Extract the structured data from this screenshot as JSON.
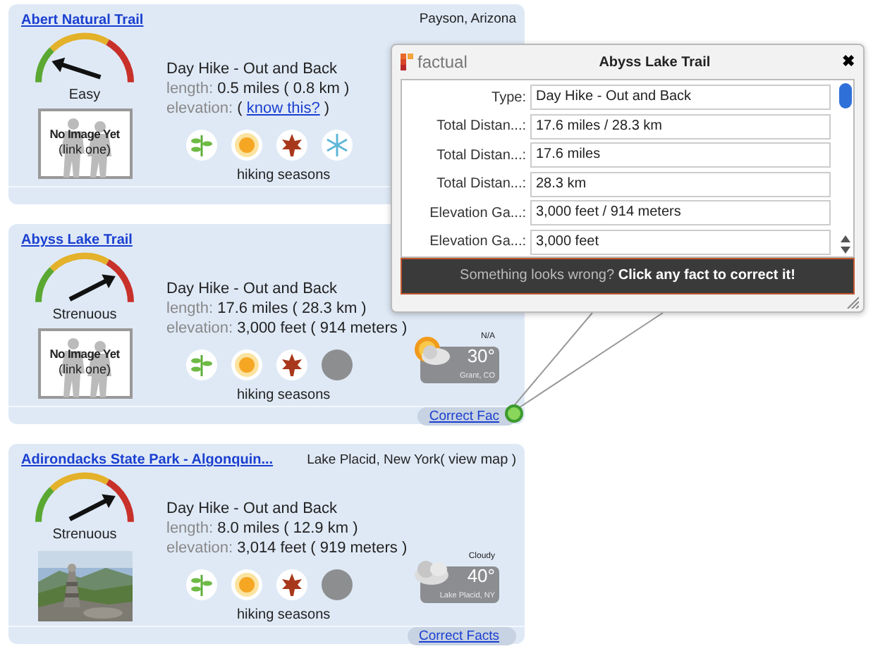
{
  "trails": [
    {
      "title": "Abert Natural Trail",
      "location": "Payson, Arizona",
      "difficulty": {
        "label": "Easy",
        "kind": "easy"
      },
      "image": {
        "kind": "placeholder",
        "caption": "No Image Yet",
        "link": "(link one)"
      },
      "type": "Day Hike - Out and Back",
      "length": {
        "label": "length:",
        "value": "0.5 miles ( 0.8 km )"
      },
      "elevation": {
        "label": "elevation:",
        "prompt": {
          "open": "(",
          "link": "know this?",
          "close": ")"
        }
      },
      "seasons": [
        {
          "kind": "spring",
          "active": true
        },
        {
          "kind": "summer",
          "active": true
        },
        {
          "kind": "fall",
          "active": true
        },
        {
          "kind": "winter",
          "active": true
        }
      ],
      "seasons_label": "hiking seasons"
    },
    {
      "title": "Abyss Lake Trail",
      "difficulty": {
        "label": "Strenuous",
        "kind": "strenuous"
      },
      "image": {
        "kind": "placeholder",
        "caption": "No Image Yet",
        "link": "(link one)"
      },
      "type": "Day Hike - Out and Back",
      "length": {
        "label": "length:",
        "value": "17.6 miles ( 28.3 km )"
      },
      "elevation": {
        "label": "elevation:",
        "value": "3,000 feet ( 914 meters )"
      },
      "seasons": [
        {
          "kind": "spring",
          "active": true
        },
        {
          "kind": "summer",
          "active": true
        },
        {
          "kind": "fall",
          "active": true
        },
        {
          "kind": "winter",
          "active": false
        }
      ],
      "seasons_label": "hiking seasons",
      "weather": {
        "kind": "partly-sunny",
        "condition": "N/A",
        "temp": "30°",
        "place": "Grant, CO"
      },
      "correct_facts": "Correct Fac"
    },
    {
      "title": "Adirondacks State Park - Algonquin...",
      "location": "Lake Placid, New York",
      "map_link": {
        "open": "(",
        "link": "view map",
        "close": ")"
      },
      "difficulty": {
        "label": "Strenuous",
        "kind": "strenuous"
      },
      "type": "Day Hike - Out and Back",
      "length": {
        "label": "length:",
        "value": "8.0 miles ( 12.9 km )"
      },
      "elevation": {
        "label": "elevation:",
        "value": "3,014 feet ( 919 meters )"
      },
      "seasons": [
        {
          "kind": "spring",
          "active": true
        },
        {
          "kind": "summer",
          "active": true
        },
        {
          "kind": "fall",
          "active": true
        },
        {
          "kind": "winter",
          "active": false
        }
      ],
      "seasons_label": "hiking seasons",
      "weather": {
        "kind": "cloudy",
        "condition": "Cloudy",
        "temp": "40°",
        "place": "Lake Placid, NY"
      },
      "correct_facts": "Correct Facts"
    }
  ],
  "popup": {
    "brand": "factual",
    "title": "Abyss Lake Trail",
    "close": "✖",
    "facts": [
      {
        "label": "Type:",
        "value": "Day Hike - Out and Back"
      },
      {
        "label": "Total Distan...:",
        "value": "17.6 miles / 28.3 km"
      },
      {
        "label": "Total Distan...:",
        "value": "17.6 miles"
      },
      {
        "label": "Total Distan...:",
        "value": "28.3 km"
      },
      {
        "label": "Elevation Ga...:",
        "value": "3,000 feet / 914 meters"
      },
      {
        "label": "Elevation Ga...:",
        "value": "3,000 feet"
      }
    ],
    "footer": "Something looks wrong? **Click any fact to correct it!**"
  }
}
